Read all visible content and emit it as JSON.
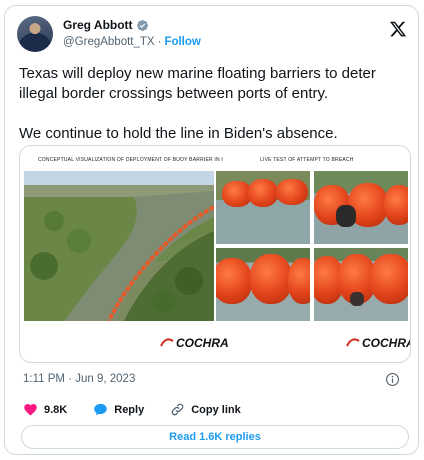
{
  "author": {
    "name": "Greg Abbott",
    "handle": "@GregAbbott_TX",
    "separator": "·",
    "follow_label": "Follow"
  },
  "tweet": {
    "line1": "Texas will deploy new marine floating barriers to deter illegal border crossings between ports of entry.",
    "line2": "We continue to hold the line in Biden's absence."
  },
  "media": {
    "caption_left": "CONCEPTUAL VISUALIZATION OF DEPLOYMENT OF BUOY BARRIER IN I",
    "caption_right": "LIVE TEST OF ATTEMPT TO BREACH",
    "brand_left": "COCHRA",
    "brand_right": "COCHRAN"
  },
  "meta": {
    "time": "1:11 PM",
    "separator": "·",
    "date": "Jun 9, 2023"
  },
  "actions": {
    "likes": "9.8K",
    "reply_label": "Reply",
    "copy_link_label": "Copy link"
  },
  "read_replies_label": "Read 1.6K replies",
  "colors": {
    "accent": "#1d9bf0",
    "like": "#f91880",
    "muted": "#536471",
    "buoy": "#e2431a"
  }
}
